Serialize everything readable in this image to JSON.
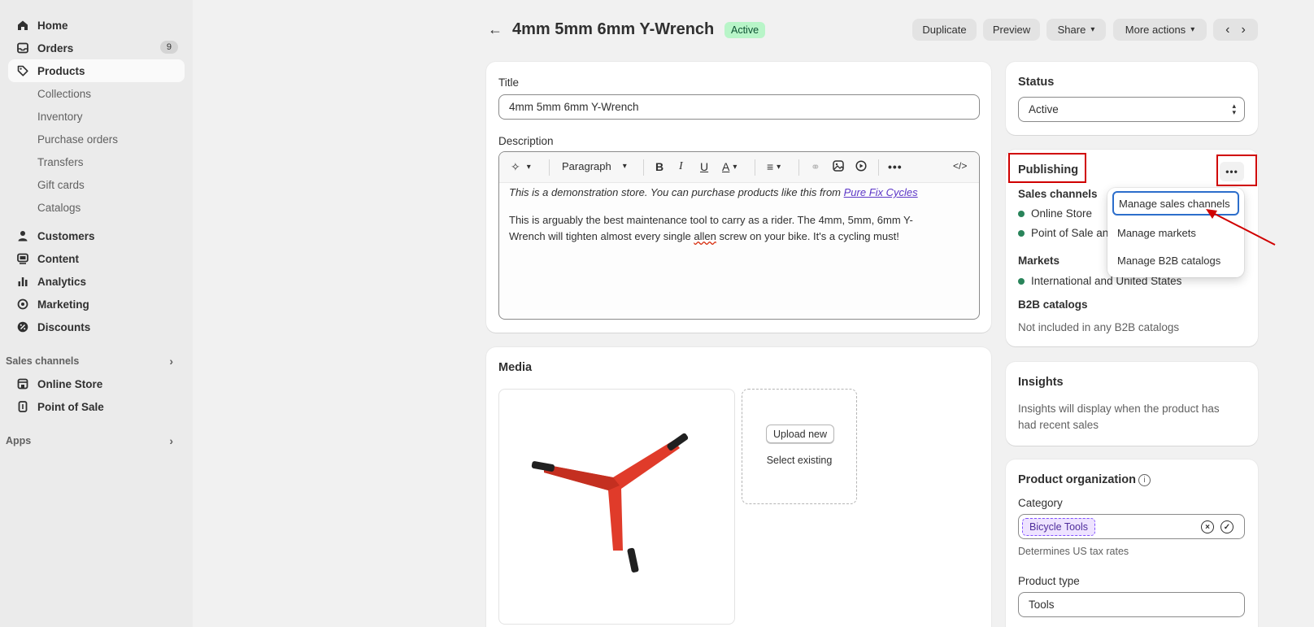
{
  "sidebar": {
    "items": [
      {
        "label": "Home",
        "icon": "home-icon"
      },
      {
        "label": "Orders",
        "icon": "inbox-icon",
        "count": "9"
      },
      {
        "label": "Products",
        "icon": "tag-icon"
      }
    ],
    "product_sub": [
      "Collections",
      "Inventory",
      "Purchase orders",
      "Transfers",
      "Gift cards",
      "Catalogs"
    ],
    "items2": [
      {
        "label": "Customers",
        "icon": "person-icon"
      },
      {
        "label": "Content",
        "icon": "content-icon"
      },
      {
        "label": "Analytics",
        "icon": "chart-bar-icon"
      },
      {
        "label": "Marketing",
        "icon": "target-icon"
      },
      {
        "label": "Discounts",
        "icon": "discount-icon"
      }
    ],
    "sales_channels_label": "Sales channels",
    "channels": [
      {
        "label": "Online Store",
        "icon": "store-icon"
      },
      {
        "label": "Point of Sale",
        "icon": "pos-icon"
      }
    ],
    "apps_label": "Apps"
  },
  "header": {
    "title": "4mm 5mm 6mm Y-Wrench",
    "status": "Active",
    "duplicate": "Duplicate",
    "preview": "Preview",
    "share": "Share",
    "more_actions": "More actions"
  },
  "product": {
    "title_label": "Title",
    "title_value": "4mm 5mm 6mm Y-Wrench",
    "description_label": "Description",
    "toolbar_format": "Paragraph",
    "desc_line1_prefix": "This is a demonstration store. You can purchase products like this from ",
    "desc_line1_link": "Pure Fix Cycles",
    "desc_para2_a": "This is arguably the best maintenance tool to carry as a rider. The 4mm, 5mm, 6mm Y-",
    "desc_para2_b": "Wrench will tighten almost every single ",
    "desc_para2_misspelled": "allen",
    "desc_para2_c": " screw on your bike. It's a cycling must!"
  },
  "media": {
    "heading": "Media",
    "upload_new": "Upload new",
    "select_existing": "Select existing"
  },
  "status_card": {
    "heading": "Status",
    "value": "Active"
  },
  "publishing": {
    "heading": "Publishing",
    "sales_channels_label": "Sales channels",
    "channel_1": "Online Store",
    "channel_2": "Point of Sale an",
    "markets_label": "Markets",
    "markets_value": "International and United States",
    "b2b_label": "B2B catalogs",
    "b2b_value": "Not included in any B2B catalogs",
    "menu": [
      "Manage sales channels",
      "Manage markets",
      "Manage B2B catalogs"
    ]
  },
  "insights": {
    "heading": "Insights",
    "text_1": "Insights will display when the product has",
    "text_2": "had recent sales"
  },
  "organization": {
    "heading": "Product organization",
    "category_label": "Category",
    "category_value": "Bicycle Tools",
    "category_help": "Determines US tax rates",
    "type_label": "Product type",
    "type_value": "Tools"
  },
  "colors": {
    "accent_red": "#d00000",
    "status_green": "#29845a",
    "link_purple": "#5c36c7"
  }
}
